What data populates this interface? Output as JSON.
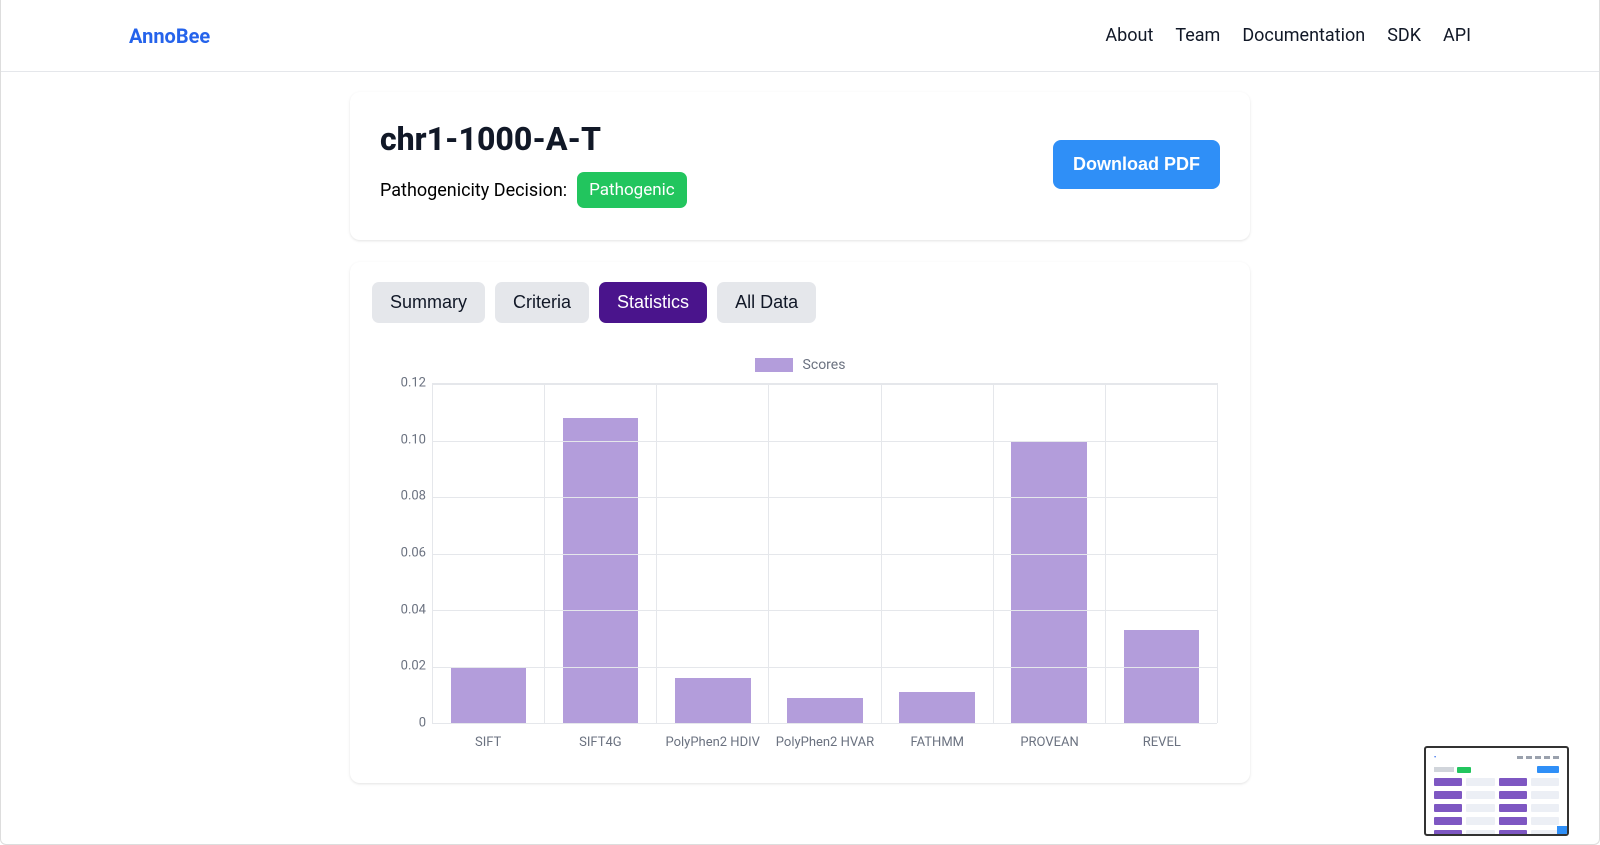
{
  "header": {
    "brand": "AnnoBee",
    "nav": [
      "About",
      "Team",
      "Documentation",
      "SDK",
      "API"
    ]
  },
  "panel": {
    "title": "chr1-1000-A-T",
    "decision_label": "Pathogenicity Decision:",
    "decision_value": "Pathogenic",
    "download_label": "Download PDF"
  },
  "tabs": [
    {
      "label": "Summary",
      "active": false
    },
    {
      "label": "Criteria",
      "active": false
    },
    {
      "label": "Statistics",
      "active": true
    },
    {
      "label": "All Data",
      "active": false
    }
  ],
  "legend_label": "Scores",
  "chart_data": {
    "type": "bar",
    "title": "",
    "xlabel": "",
    "ylabel": "",
    "ylim": [
      0,
      0.12
    ],
    "yticks": [
      0,
      0.02,
      0.04,
      0.06,
      0.08,
      0.1,
      0.12
    ],
    "categories": [
      "SIFT",
      "SIFT4G",
      "PolyPhen2 HDIV",
      "PolyPhen2 HVAR",
      "FATHMM",
      "PROVEAN",
      "REVEL"
    ],
    "series": [
      {
        "name": "Scores",
        "values": [
          0.02,
          0.108,
          0.016,
          0.009,
          0.011,
          0.1,
          0.033
        ]
      }
    ],
    "color": "#b39ddb"
  }
}
